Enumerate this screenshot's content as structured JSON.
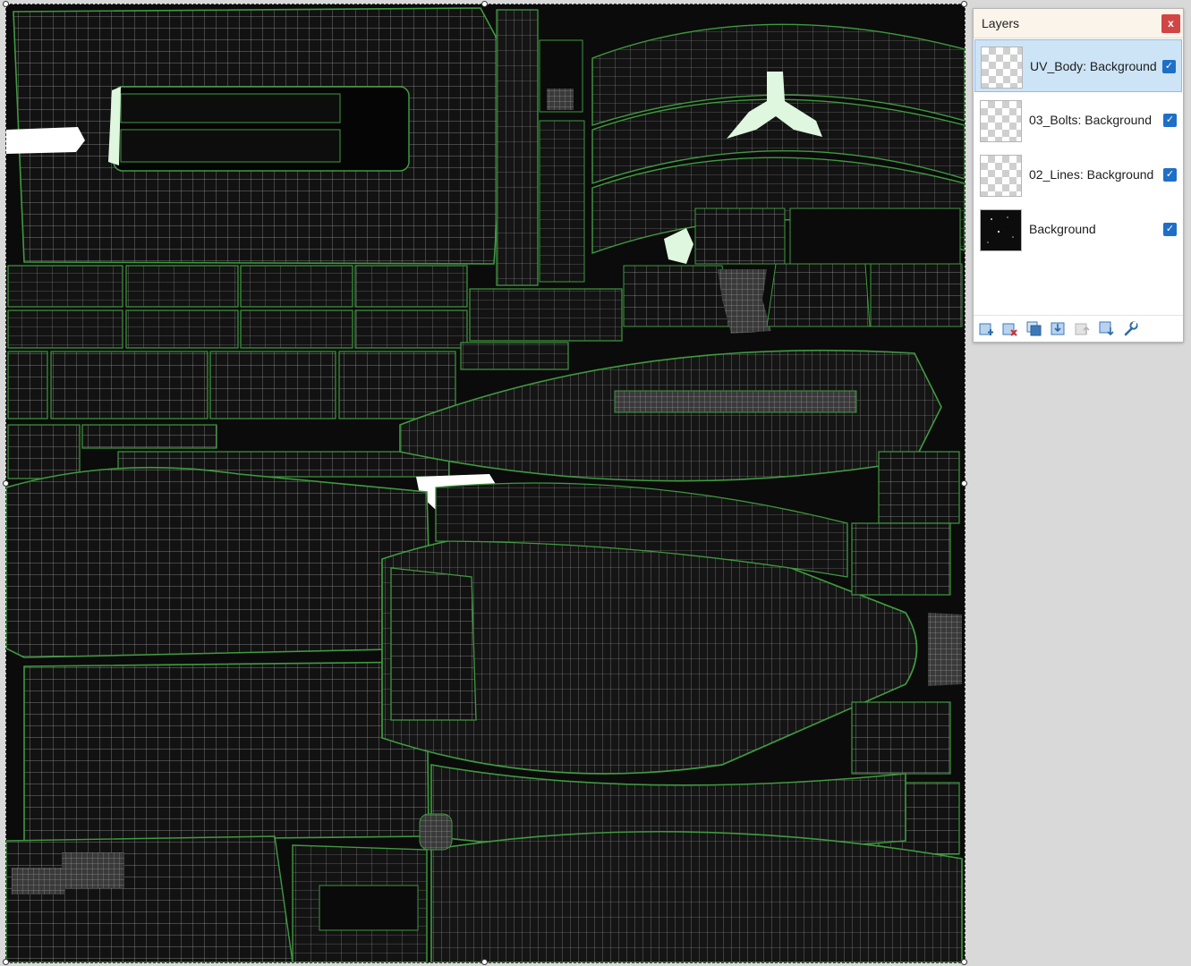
{
  "layers_panel": {
    "title": "Layers",
    "close_label": "x",
    "layers": [
      {
        "name": "UV_Body: Background",
        "visible": true,
        "selected": true,
        "thumbnail": "transparent-checker"
      },
      {
        "name": "03_Bolts: Background",
        "visible": true,
        "selected": false,
        "thumbnail": "transparent-checker"
      },
      {
        "name": "02_Lines: Background",
        "visible": true,
        "selected": false,
        "thumbnail": "transparent-checker"
      },
      {
        "name": "Background",
        "visible": true,
        "selected": false,
        "thumbnail": "dark-texture"
      }
    ],
    "toolbar_icons": [
      "add-layer-icon",
      "delete-layer-icon",
      "duplicate-layer-icon",
      "merge-layer-down-icon",
      "move-layer-up-icon",
      "move-layer-down-icon",
      "layer-properties-icon"
    ]
  },
  "colors": {
    "uv_wire": "#c8c8c8",
    "uv_seam": "#3f9a3f",
    "uv_fill": "#141414",
    "uv_island_light": "#dff6df",
    "selection_accent": "#cde4f7",
    "checkbox": "#1e6fc7",
    "close": "#d24545"
  }
}
